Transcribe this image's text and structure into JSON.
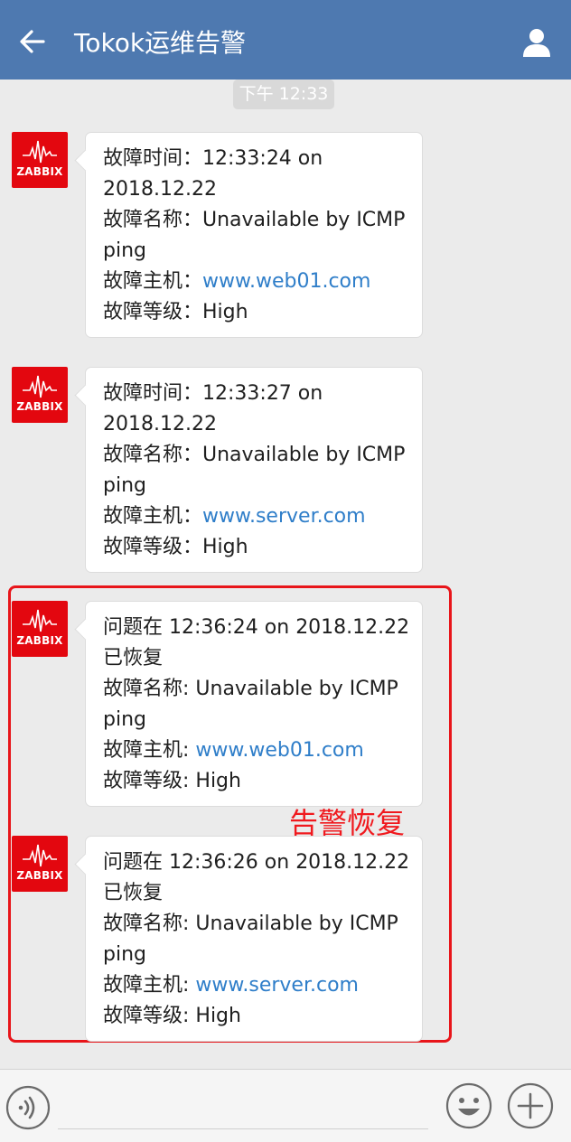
{
  "header": {
    "title": "Tokok运维告警",
    "back_icon": "back-arrow-icon",
    "profile_icon": "person-icon",
    "color": "#4e79b0"
  },
  "timestamp": "下午 12:33",
  "avatar": {
    "label": "ZABBIX",
    "color": "#e3070f"
  },
  "messages": [
    {
      "lines": [
        {
          "prefix": "故障时间：12:33:24 on",
          "link": ""
        },
        {
          "prefix": "2018.12.22",
          "link": ""
        },
        {
          "prefix": "故障名称：Unavailable by ICMP",
          "link": ""
        },
        {
          "prefix": "ping",
          "link": ""
        },
        {
          "prefix": "故障主机：",
          "link": "www.web01.com"
        },
        {
          "prefix": "故障等级：High",
          "link": ""
        }
      ]
    },
    {
      "lines": [
        {
          "prefix": "故障时间：12:33:27 on",
          "link": ""
        },
        {
          "prefix": "2018.12.22",
          "link": ""
        },
        {
          "prefix": "故障名称：Unavailable by ICMP",
          "link": ""
        },
        {
          "prefix": "ping",
          "link": ""
        },
        {
          "prefix": "故障主机：",
          "link": "www.server.com"
        },
        {
          "prefix": "故障等级：High",
          "link": ""
        }
      ]
    },
    {
      "lines": [
        {
          "prefix": "问题在 12:36:24 on 2018.12.22",
          "link": ""
        },
        {
          "prefix": "已恢复",
          "link": ""
        },
        {
          "prefix": "故障名称: Unavailable by ICMP",
          "link": ""
        },
        {
          "prefix": "ping",
          "link": ""
        },
        {
          "prefix": "故障主机: ",
          "link": "www.web01.com"
        },
        {
          "prefix": "故障等级: High",
          "link": ""
        }
      ]
    },
    {
      "lines": [
        {
          "prefix": "问题在 12:36:26 on 2018.12.22",
          "link": ""
        },
        {
          "prefix": "已恢复",
          "link": ""
        },
        {
          "prefix": "故障名称: Unavailable by ICMP",
          "link": ""
        },
        {
          "prefix": "ping",
          "link": ""
        },
        {
          "prefix": "故障主机: ",
          "link": "www.server.com"
        },
        {
          "prefix": "故障等级: High",
          "link": ""
        }
      ]
    }
  ],
  "annotation": {
    "text": "告警恢复",
    "color": "#f0191e"
  },
  "input_bar": {
    "voice_icon": "voice-icon",
    "emoji_icon": "emoji-icon",
    "plus_icon": "plus-icon",
    "placeholder": ""
  },
  "link_color": "#2f7ec9"
}
